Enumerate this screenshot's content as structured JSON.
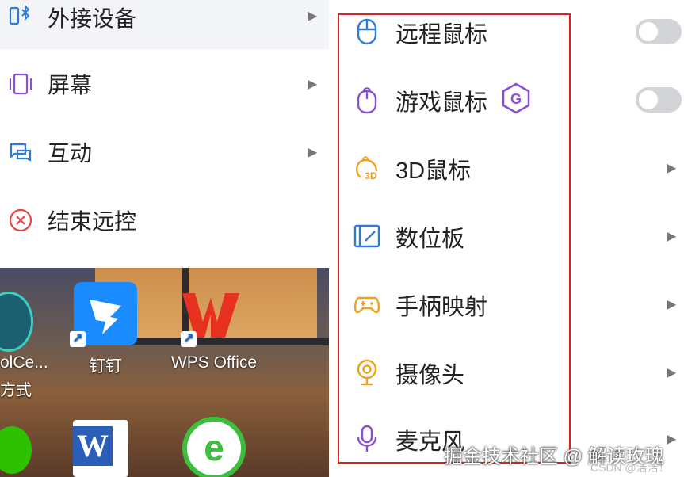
{
  "left_menu": {
    "items": [
      {
        "label": "外接设备",
        "icon": "external-device-icon",
        "active": true
      },
      {
        "label": "屏幕",
        "icon": "screen-icon"
      },
      {
        "label": "互动",
        "icon": "interaction-icon"
      },
      {
        "label": "结束远控",
        "icon": "end-remote-icon"
      }
    ]
  },
  "submenu": {
    "items": [
      {
        "label": "远程鼠标",
        "icon": "mouse-icon",
        "control": "toggle",
        "on": false
      },
      {
        "label": "游戏鼠标",
        "icon": "gaming-mouse-icon",
        "badge": "G",
        "control": "toggle",
        "on": false
      },
      {
        "label": "3D鼠标",
        "icon": "3d-mouse-icon",
        "control": "chevron"
      },
      {
        "label": "数位板",
        "icon": "tablet-icon",
        "control": "chevron"
      },
      {
        "label": "手柄映射",
        "icon": "gamepad-icon",
        "control": "chevron"
      },
      {
        "label": "摄像头",
        "icon": "camera-icon",
        "control": "chevron"
      },
      {
        "label": "麦克风",
        "icon": "microphone-icon",
        "control": "chevron"
      }
    ]
  },
  "desktop": {
    "icons": [
      {
        "label": "olCe...",
        "sublabel": "方式"
      },
      {
        "label": "钉钉"
      },
      {
        "label": "WPS Office"
      }
    ]
  },
  "watermark": "掘金技术社区 @ 解读玫瑰",
  "credit": "CSDN @洁洁！",
  "colors": {
    "accent": "#2e7bd6",
    "purple": "#8a4fd8",
    "orange": "#f0a020",
    "highlight": "#e02020"
  }
}
